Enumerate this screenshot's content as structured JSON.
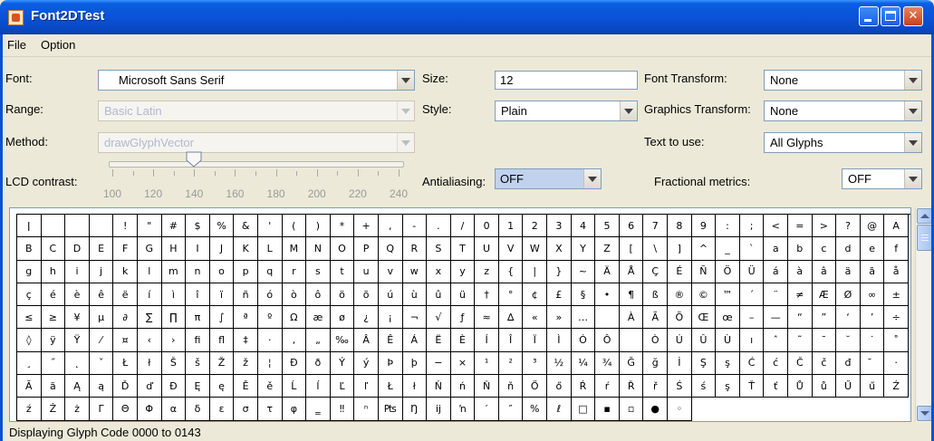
{
  "window": {
    "title": "Font2DTest"
  },
  "menu": [
    "File",
    "Option"
  ],
  "controls": {
    "font_label": "Font:",
    "font_value": "Microsoft Sans Serif",
    "range_label": "Range:",
    "range_value": "Basic Latin",
    "method_label": "Method:",
    "method_value": "drawGlyphVector",
    "size_label": "Size:",
    "size_value": "12",
    "style_label": "Style:",
    "style_value": "Plain",
    "font_transform_label": "Font Transform:",
    "font_transform_value": "None",
    "graphics_transform_label": "Graphics Transform:",
    "graphics_transform_value": "None",
    "text_to_use_label": "Text to use:",
    "text_to_use_value": "All Glyphs",
    "lcd_label": "LCD contrast:",
    "lcd_value": 140,
    "lcd_min": 100,
    "lcd_max": 250,
    "lcd_ticks": [
      "100",
      "120",
      "140",
      "160",
      "180",
      "200",
      "220",
      "240"
    ],
    "antialiasing_label": "Antialiasing:",
    "antialiasing_value": "OFF",
    "fractional_label": "Fractional metrics:",
    "fractional_value": "OFF"
  },
  "glyphs": [
    "ǀ",
    "",
    "",
    "",
    "!",
    "\"",
    "#",
    "$",
    "%",
    "&",
    "'",
    "(",
    ")",
    "*",
    "+",
    ",",
    "-",
    ".",
    "/",
    "0",
    "1",
    "2",
    "3",
    "4",
    "5",
    "6",
    "7",
    "8",
    "9",
    ":",
    ";",
    "<",
    "=",
    ">",
    "?",
    "@",
    "A",
    "B",
    "C",
    "D",
    "E",
    "F",
    "G",
    "H",
    "I",
    "J",
    "K",
    "L",
    "M",
    "N",
    "O",
    "P",
    "Q",
    "R",
    "S",
    "T",
    "U",
    "V",
    "W",
    "X",
    "Y",
    "Z",
    "[",
    "\\",
    "]",
    "^",
    "_",
    "`",
    "a",
    "b",
    "c",
    "d",
    "e",
    "f",
    "g",
    "h",
    "i",
    "j",
    "k",
    "l",
    "m",
    "n",
    "o",
    "p",
    "q",
    "r",
    "s",
    "t",
    "u",
    "v",
    "w",
    "x",
    "y",
    "z",
    "{",
    "|",
    "}",
    "~",
    "Ä",
    "Å",
    "Ç",
    "É",
    "Ñ",
    "Ö",
    "Ü",
    "á",
    "à",
    "â",
    "ä",
    "ã",
    "å",
    "ç",
    "é",
    "è",
    "ê",
    "ë",
    "í",
    "ì",
    "î",
    "ï",
    "ñ",
    "ó",
    "ò",
    "ô",
    "ö",
    "õ",
    "ú",
    "ù",
    "û",
    "ü",
    "†",
    "°",
    "¢",
    "£",
    "§",
    "•",
    "¶",
    "ß",
    "®",
    "©",
    "™",
    "´",
    "¨",
    "≠",
    "Æ",
    "Ø",
    "∞",
    "±",
    "≤",
    "≥",
    "¥",
    "µ",
    "∂",
    "∑",
    "∏",
    "π",
    "∫",
    "ª",
    "º",
    "Ω",
    "æ",
    "ø",
    "¿",
    "¡",
    "¬",
    "√",
    "ƒ",
    "≈",
    "∆",
    "«",
    "»",
    "…",
    " ",
    "À",
    "Ã",
    "Õ",
    "Œ",
    "œ",
    "–",
    "—",
    "“",
    "”",
    "‘",
    "’",
    "÷",
    "◊",
    "ÿ",
    "Ÿ",
    "⁄",
    "¤",
    "‹",
    "›",
    "ﬁ",
    "ﬂ",
    "‡",
    "·",
    "‚",
    "„",
    "‰",
    "Â",
    "Ê",
    "Á",
    "Ë",
    "È",
    "Í",
    "Î",
    "Ï",
    "Ì",
    "Ó",
    "Ô",
    "",
    "Ò",
    "Ú",
    "Û",
    "Ù",
    "ı",
    "ˆ",
    "˜",
    "¯",
    "˘",
    "˙",
    "˚",
    "¸",
    "˝",
    "˛",
    "ˇ",
    "Ł",
    "ł",
    "Š",
    "š",
    "Ž",
    "ž",
    "¦",
    "Ð",
    "ð",
    "Ý",
    "ý",
    "Þ",
    "þ",
    "−",
    "×",
    "¹",
    "²",
    "³",
    "½",
    "¼",
    "¾",
    "Ğ",
    "ğ",
    "İ",
    "Ş",
    "ş",
    "Ć",
    "ć",
    "Č",
    "č",
    "đ",
    "̄",
    "·",
    "Ă",
    "ă",
    "Ą",
    "ą",
    "Ď",
    "ď",
    "Đ",
    "Ę",
    "ę",
    "Ě",
    "ě",
    "Ĺ",
    "ĺ",
    "Ľ",
    "ľ",
    "Ł",
    "ł",
    "Ń",
    "ń",
    "Ň",
    "ň",
    "Ő",
    "ő",
    "Ŕ",
    "ŕ",
    "Ř",
    "ř",
    "Ś",
    "ś",
    "ş",
    "Ť",
    "ť",
    "Ů",
    "ů",
    "Ű",
    "ű",
    "Ź",
    "ź",
    "Ż",
    "ż",
    "Γ",
    "Θ",
    "Φ",
    "α",
    "δ",
    "ε",
    "σ",
    "τ",
    "φ",
    "‗",
    "‼",
    "ⁿ",
    "₧",
    "Ŋ",
    "ĳ",
    "ŉ",
    "′",
    "″",
    "%",
    "ℓ",
    "□",
    "▪",
    "▫",
    "●",
    "◦"
  ],
  "status": "Displaying Glyph Code 0000 to 0143",
  "colors": {
    "titlebar": "#0a52d8",
    "window_bg": "#ece9d8",
    "selected_combo": "#c1d2ee",
    "disabled_text": "#b0b8d0"
  }
}
